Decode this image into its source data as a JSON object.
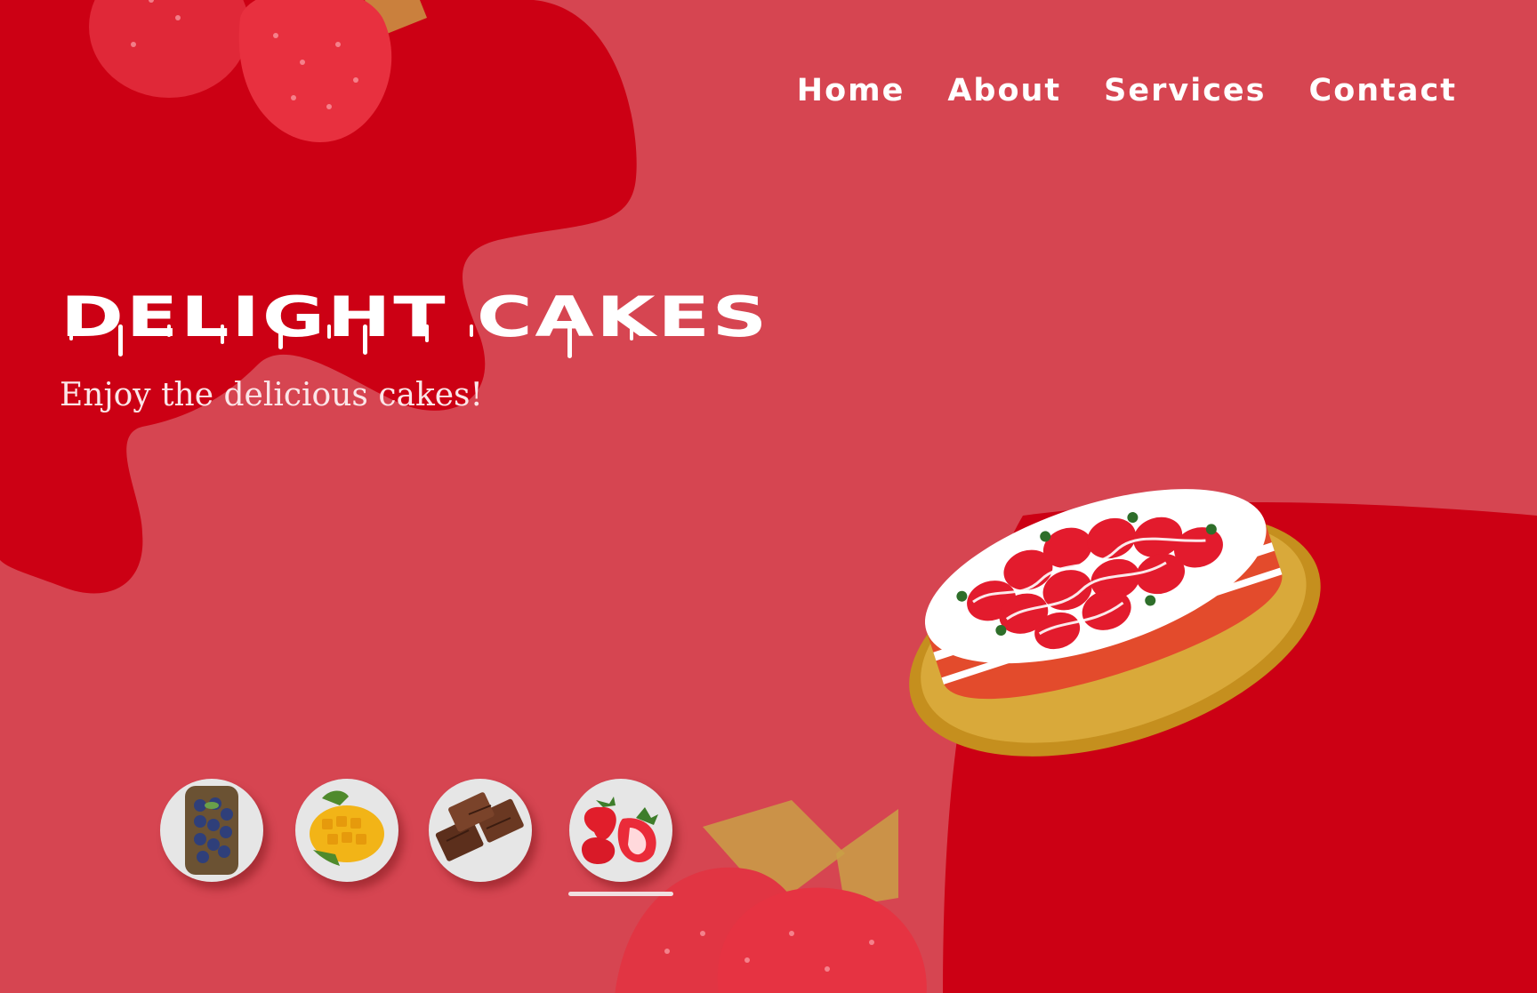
{
  "nav": {
    "items": [
      {
        "label": "Home"
      },
      {
        "label": "About"
      },
      {
        "label": "Services"
      },
      {
        "label": "Contact"
      }
    ]
  },
  "hero": {
    "title": "DELIGHT CAKES",
    "subtitle": "Enjoy the delicious cakes!"
  },
  "flavors": [
    {
      "icon": "blueberry-icon"
    },
    {
      "icon": "mango-icon"
    },
    {
      "icon": "chocolate-icon"
    },
    {
      "icon": "strawberry-icon",
      "active": true
    }
  ],
  "colors": {
    "background": "#d64551",
    "blob": "#cc0014",
    "text": "#ffffff"
  }
}
